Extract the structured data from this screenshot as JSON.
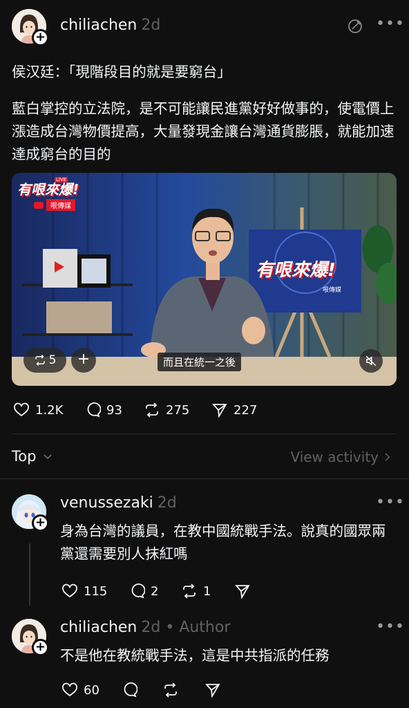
{
  "post": {
    "username": "chiliachen",
    "time": "2d",
    "title": "侯汉廷：「現階段目的就是要窮台」",
    "body": "藍白掌控的立法院，是不可能讓民進黨好好做事的，使電價上漲造成台灣物價提高，大量發現金讓台灣通貨膨脹，就能加速達成窮台的目的",
    "video": {
      "logo": "有哏來爆!",
      "live_tag": "LIVE",
      "brand": "哏傳媒",
      "board_text": "有哏來爆!",
      "board_brand": "哏傳媒",
      "subtitle": "而且在統一之後",
      "repost_count": "5",
      "add": "+"
    },
    "stats": {
      "likes": "1.2K",
      "replies": "93",
      "reposts": "275",
      "shares": "227"
    }
  },
  "filter": {
    "sort": "Top",
    "activity": "View activity"
  },
  "replies": [
    {
      "username": "venussezaki",
      "time": "2d",
      "text": "身為台灣的議員，在教中國統戰手法。說真的國眾兩黨還需要別人抹紅嗎",
      "likes": "115",
      "replies": "2",
      "reposts": "1"
    },
    {
      "username": "chiliachen",
      "time": "2d",
      "author_label": "• Author",
      "text": "不是他在教統戰手法，這是中共指派的任務",
      "likes": "60"
    }
  ],
  "colors": {
    "background": "#101010",
    "text": "#f3f5f7",
    "muted": "#616161"
  }
}
